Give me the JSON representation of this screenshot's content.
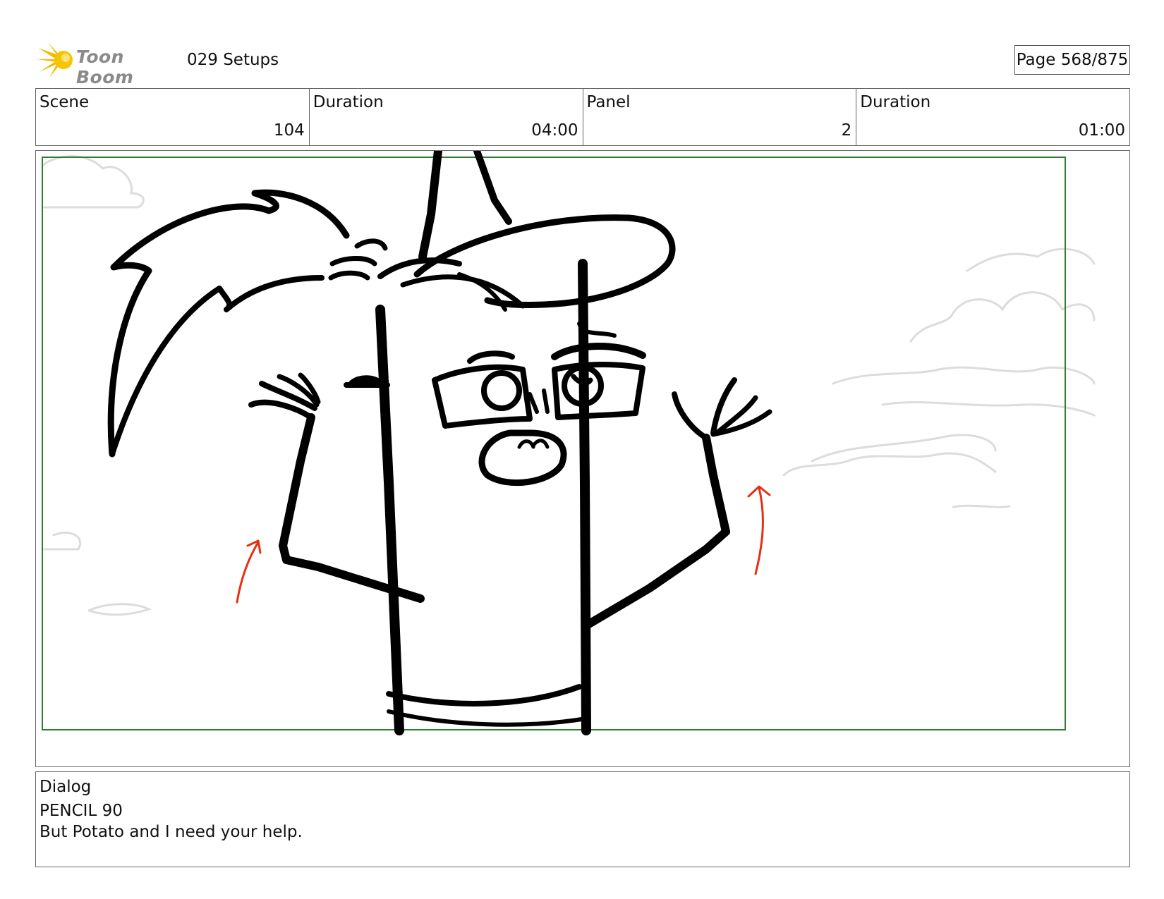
{
  "header": {
    "logo_text": "Toon Boom",
    "project_title": "029 Setups",
    "page_label": "Page 568/875"
  },
  "info": {
    "scene_label": "Scene",
    "scene_value": "104",
    "scene_duration_label": "Duration",
    "scene_duration_value": "04:00",
    "panel_label": "Panel",
    "panel_value": "2",
    "panel_duration_label": "Duration",
    "panel_duration_value": "01:00"
  },
  "panel": {
    "safe_frame_color": "#2e7d32",
    "ink_color": "#000000",
    "arrow_color": "#e53012",
    "cloud_color": "#d9d9d9"
  },
  "dialog": {
    "label": "Dialog",
    "speaker": "PENCIL 90",
    "line": "But Potato and I need your help."
  }
}
